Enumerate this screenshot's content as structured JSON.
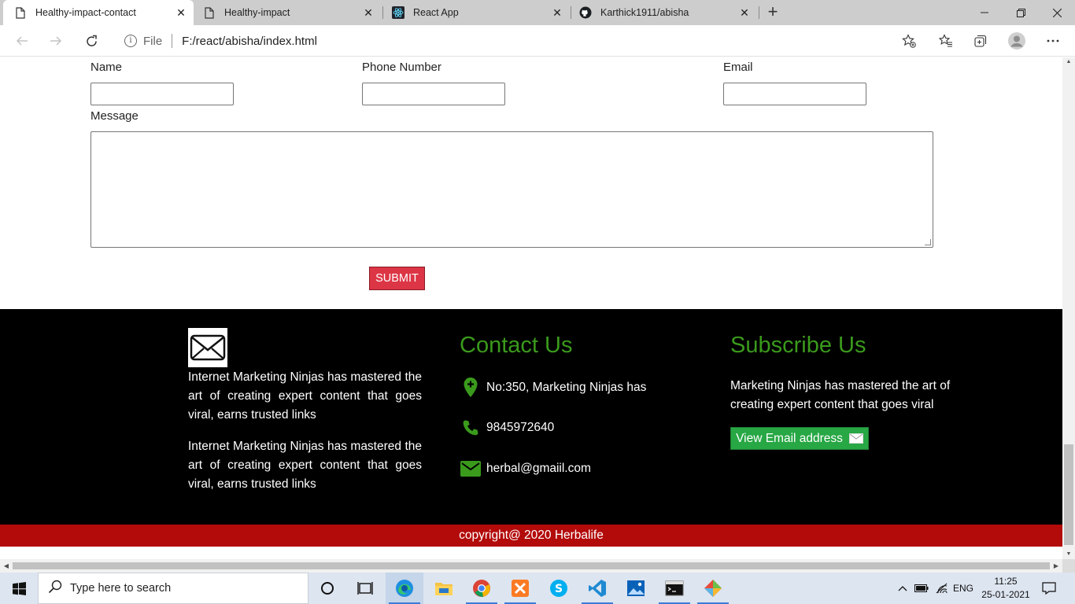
{
  "browser": {
    "tabs": [
      {
        "label": "Healthy-impact-contact",
        "icon": "page-icon",
        "active": true
      },
      {
        "label": "Healthy-impact",
        "icon": "page-icon",
        "active": false
      },
      {
        "label": "React App",
        "icon": "react-icon",
        "active": false
      },
      {
        "label": "Karthick1911/abisha",
        "icon": "github-icon",
        "active": false
      }
    ],
    "tab_close_glyph": "✕",
    "new_tab_glyph": "+",
    "address": {
      "scheme": "File",
      "url": "F:/react/abisha/index.html"
    }
  },
  "form": {
    "name_label": "Name",
    "phone_label": "Phone Number",
    "email_label": "Email",
    "message_label": "Message",
    "name_value": "",
    "phone_value": "",
    "email_value": "",
    "message_value": "",
    "submit_label": "SUBMIT"
  },
  "footer": {
    "about_paragraph_1": "Internet Marketing Ninjas has mastered the art of creating expert content that goes viral, earns trusted links",
    "about_paragraph_2": "Internet Marketing Ninjas has mastered the art of creating expert content that goes viral, earns trusted links",
    "contact_heading": "Contact Us",
    "address": "No:350, Marketing Ninjas has",
    "phone": "9845972640",
    "email": "herbal@gmaiil.com",
    "subscribe_heading": "Subscribe Us",
    "subscribe_text": "Marketing Ninjas has mastered the art of creating expert content that goes viral",
    "email_button_label": "View Email address",
    "copyright": "copyright@ 2020 Herbalife"
  },
  "colors": {
    "accent_green": "#3a9a1c",
    "submit_red": "#dc3545",
    "copyright_red": "#b30a0a",
    "button_green": "#28a745"
  },
  "taskbar": {
    "search_placeholder": "Type here to search",
    "apps": [
      "task-view-icon",
      "edge-icon",
      "file-explorer-icon",
      "chrome-icon",
      "xampp-icon",
      "skype-icon",
      "vscode-icon",
      "photos-icon",
      "terminal-icon",
      "git-icon"
    ],
    "language": "ENG",
    "time": "11:25",
    "date": "25-01-2021"
  }
}
